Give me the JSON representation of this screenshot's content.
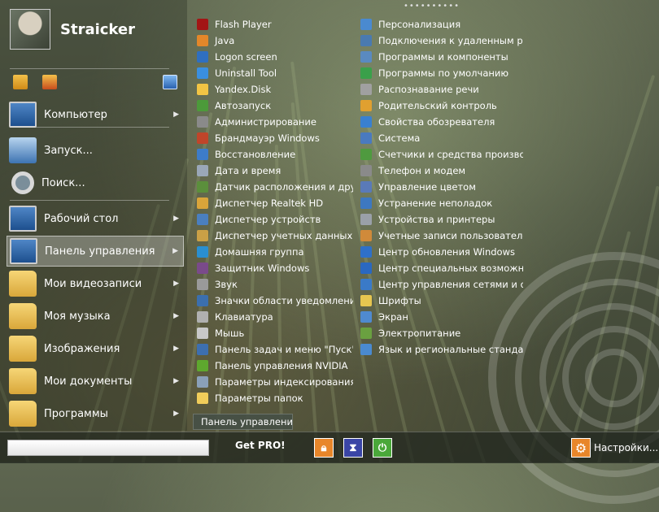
{
  "user": {
    "name": "Straicker"
  },
  "quick_icons": [
    "add-program-icon",
    "remove-program-icon",
    "window-icon"
  ],
  "nav": [
    {
      "label": "Компьютер",
      "icon": "computer-icon",
      "arrow": true
    },
    {
      "label": "Запуск...",
      "icon": "run-icon",
      "arrow": false
    },
    {
      "label": "Поиск...",
      "icon": "search-icon",
      "arrow": false
    },
    {
      "label": "Рабочий стол",
      "icon": "desktop-icon",
      "arrow": true
    },
    {
      "label": "Панель управления",
      "icon": "control-panel-icon",
      "arrow": true,
      "active": true
    },
    {
      "label": "Мои видеозаписи",
      "icon": "folder-icon",
      "arrow": true
    },
    {
      "label": "Моя музыка",
      "icon": "folder-icon",
      "arrow": true
    },
    {
      "label": "Изображения",
      "icon": "folder-icon",
      "arrow": true
    },
    {
      "label": "Мои документы",
      "icon": "folder-icon",
      "arrow": true
    },
    {
      "label": "Программы",
      "icon": "folder-icon",
      "arrow": true
    }
  ],
  "arrow_glyph": "▶",
  "control_panel": {
    "column1": [
      {
        "label": "Flash Player",
        "color": "#a31515"
      },
      {
        "label": "Java",
        "color": "#e3872a"
      },
      {
        "label": "Logon screen",
        "color": "#2f6fc0"
      },
      {
        "label": "Uninstall Tool",
        "color": "#3a8fe0"
      },
      {
        "label": "Yandex.Disk",
        "color": "#f2c444"
      },
      {
        "label": "Автозапуск",
        "color": "#4c9a3a"
      },
      {
        "label": "Администрирование",
        "color": "#8a8a8a"
      },
      {
        "label": "Брандмауэр Windows",
        "color": "#c0452a"
      },
      {
        "label": "Восстановление",
        "color": "#3d7cc9"
      },
      {
        "label": "Дата и время",
        "color": "#9aa7b8"
      },
      {
        "label": "Датчик расположения и друг",
        "color": "#5b8f3c"
      },
      {
        "label": "Диспетчер Realtek HD",
        "color": "#d9a53a"
      },
      {
        "label": "Диспетчер устройств",
        "color": "#4a7fbf"
      },
      {
        "label": "Диспетчер учетных данных",
        "color": "#caa046"
      },
      {
        "label": "Домашняя группа",
        "color": "#2a8fd0"
      },
      {
        "label": "Защитник Windows",
        "color": "#7a4a8a"
      },
      {
        "label": "Звук",
        "color": "#9a9a9a"
      },
      {
        "label": "Значки области уведомлений",
        "color": "#3b6fae"
      },
      {
        "label": "Клавиатура",
        "color": "#b0b0b0"
      },
      {
        "label": "Мышь",
        "color": "#c8c8c8"
      },
      {
        "label": "Панель задач и меню \"Пуск\"",
        "color": "#3d6fb0"
      },
      {
        "label": "Панель управления NVIDIA",
        "color": "#5ea82e"
      },
      {
        "label": "Параметры индексирования",
        "color": "#8aa0b8"
      },
      {
        "label": "Параметры папок",
        "color": "#f0cc5a"
      }
    ],
    "column2": [
      {
        "label": "Персонализация",
        "color": "#4a8ad0"
      },
      {
        "label": "Подключения к удаленным р",
        "color": "#4a7ab0"
      },
      {
        "label": "Программы и компоненты",
        "color": "#5a8ac0"
      },
      {
        "label": "Программы по умолчанию",
        "color": "#3aa04a"
      },
      {
        "label": "Распознавание речи",
        "color": "#a0a0a0"
      },
      {
        "label": "Родительский контроль",
        "color": "#e0a030"
      },
      {
        "label": "Свойства обозревателя",
        "color": "#3a80d0"
      },
      {
        "label": "Система",
        "color": "#4a7abf"
      },
      {
        "label": "Счетчики и средства произво",
        "color": "#4f9a3f"
      },
      {
        "label": "Телефон и модем",
        "color": "#8a8a8a"
      },
      {
        "label": "Управление цветом",
        "color": "#5a7ab8"
      },
      {
        "label": "Устранение неполадок",
        "color": "#3d78c0"
      },
      {
        "label": "Устройства и принтеры",
        "color": "#9aa0a8"
      },
      {
        "label": "Учетные записи пользователе",
        "color": "#d08a3a"
      },
      {
        "label": "Центр обновления Windows",
        "color": "#2f70c8"
      },
      {
        "label": "Центр специальных возможн",
        "color": "#2a68c0"
      },
      {
        "label": "Центр управления сетями и о",
        "color": "#3a7ac8"
      },
      {
        "label": "Шрифты",
        "color": "#e6c650"
      },
      {
        "label": "Экран",
        "color": "#4f8ad0"
      },
      {
        "label": "Электропитание",
        "color": "#6aa040"
      },
      {
        "label": "Язык и региональные стандар",
        "color": "#4a8ad0"
      }
    ],
    "tooltip": "Панель управлени",
    "top_dots": "••••••••••"
  },
  "bottom": {
    "search_value": "",
    "get_pro": "Get PRO!",
    "buttons": [
      {
        "icon": "lock-icon",
        "color": "#e8862a"
      },
      {
        "icon": "hourglass-icon",
        "color": "#3a45a6"
      },
      {
        "icon": "power-icon",
        "color": "#4aa83a"
      }
    ],
    "settings_label": "Настройки..."
  }
}
